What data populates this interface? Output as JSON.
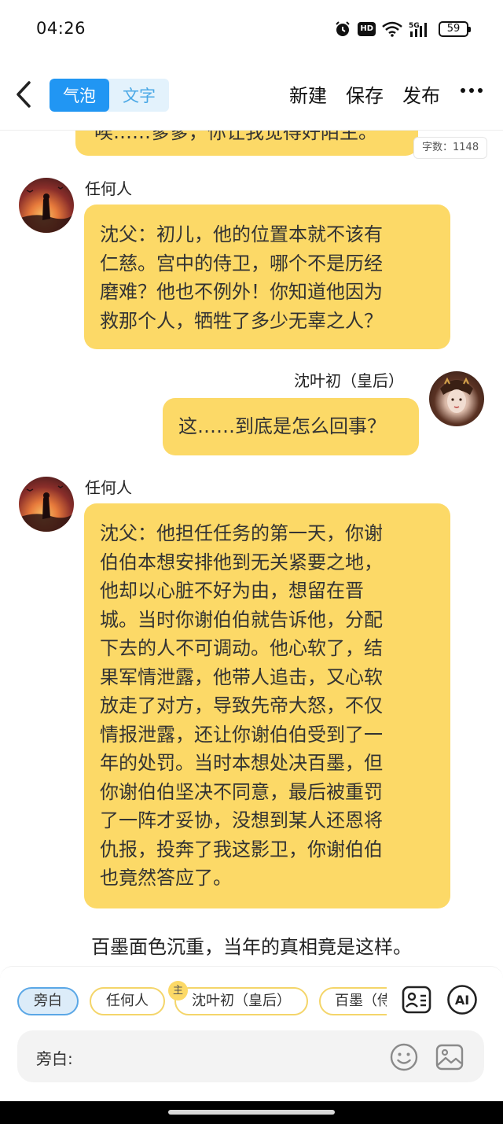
{
  "status_bar": {
    "time": "04:26",
    "hd": "HD",
    "network": "5G",
    "battery": "59",
    "icons": [
      "alarm-icon",
      "hd-icon",
      "wifi-icon",
      "signal-icon",
      "battery-icon"
    ]
  },
  "header": {
    "tabs": [
      {
        "label": "气泡",
        "active": true
      },
      {
        "label": "文字",
        "active": false
      }
    ],
    "actions": {
      "new": "新建",
      "save": "保存",
      "publish": "发布"
    },
    "accent": "#2196f3"
  },
  "chat": {
    "word_count": "字数：1148",
    "truncated_top": "唉……爹爹，你让我觉得好陌生。",
    "messages": [
      {
        "speaker": "任何人",
        "side": "left",
        "lines": [
          "沈父：初儿，他的位置本就不该有",
          "仁慈。宫中的侍卫，哪个不是历经",
          "磨难？他也不例外！你知道他因为",
          "救那个人，牺牲了多少无辜之人？"
        ]
      },
      {
        "speaker": "沈叶初（皇后）",
        "side": "right",
        "lines": [
          "这……到底是怎么回事？"
        ]
      },
      {
        "speaker": "任何人",
        "side": "left",
        "lines": [
          "沈父：他担任任务的第一天，你谢",
          "伯伯本想安排他到无关紧要之地，",
          "他却以心脏不好为由，想留在晋",
          "城。当时你谢伯伯就告诉他，分配",
          "下去的人不可调动。他心软了，结",
          "果军情泄露，他带人追击，又心软",
          "放走了对方，导致先帝大怒，不仅",
          "情报泄露，还让你谢伯伯受到了一",
          "年的处罚。当时本想处决百墨，但",
          "你谢伯伯坚决不同意，最后被重罚",
          "了一阵才妥协，没想到某人还恩将",
          "仇报，投奔了我这影卫，你谢伯伯",
          "也竟然答应了。"
        ]
      }
    ],
    "narration": "百墨面色沉重，当年的真相竟是这样。",
    "bubble_color": "#fcd967"
  },
  "composer": {
    "roles": [
      {
        "label": "旁白",
        "active": true
      },
      {
        "label": "任何人",
        "active": false
      },
      {
        "label": "沈叶初（皇后）",
        "active": false
      },
      {
        "label": "百墨（侍",
        "active": false
      }
    ],
    "main_badge": "主",
    "ai_label": "AI",
    "input_label": "旁白:"
  }
}
